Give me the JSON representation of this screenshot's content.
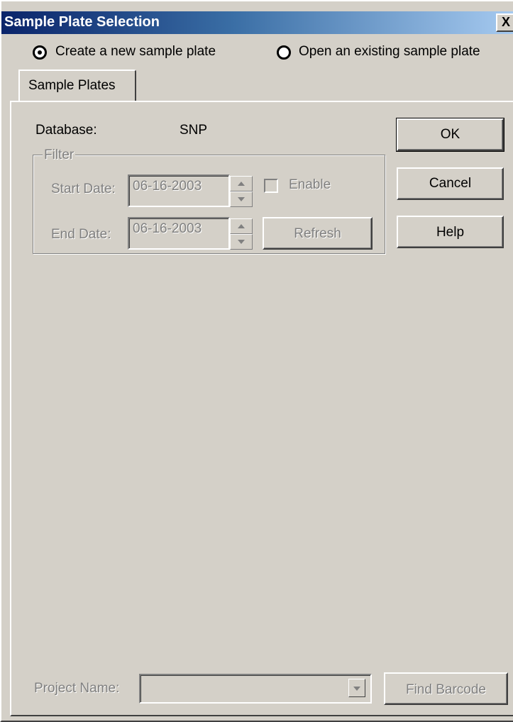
{
  "window": {
    "title": "Sample Plate Selection",
    "close_glyph": "X"
  },
  "mode": {
    "options": [
      {
        "label": "Create a new sample plate",
        "selected": true
      },
      {
        "label": "Open an existing sample plate",
        "selected": false
      }
    ]
  },
  "tabs": [
    {
      "label": "Sample Plates",
      "active": true
    }
  ],
  "database": {
    "label": "Database:",
    "value": "SNP"
  },
  "filter": {
    "legend": "Filter",
    "enabled": false,
    "start_date": {
      "label": "Start Date:",
      "value": "06-16-2003"
    },
    "end_date": {
      "label": "End Date:",
      "value": "06-16-2003"
    },
    "enable_checkbox": {
      "label": "Enable",
      "checked": false
    },
    "refresh_label": "Refresh"
  },
  "buttons": {
    "ok": "OK",
    "cancel": "Cancel",
    "help": "Help",
    "find_barcode": "Find Barcode"
  },
  "project": {
    "label": "Project Name:",
    "value": ""
  },
  "colors": {
    "face": "#d4d0c8",
    "title_start": "#0a246a",
    "title_end": "#a6caf0",
    "disabled_text": "#808080"
  },
  "icons": {
    "radio_selected": "radio-selected-icon",
    "radio_unselected": "radio-unselected-icon",
    "close": "close-icon",
    "spin_up": "spin-up-arrow-icon",
    "spin_down": "spin-down-arrow-icon",
    "combo_down": "dropdown-arrow-icon"
  }
}
